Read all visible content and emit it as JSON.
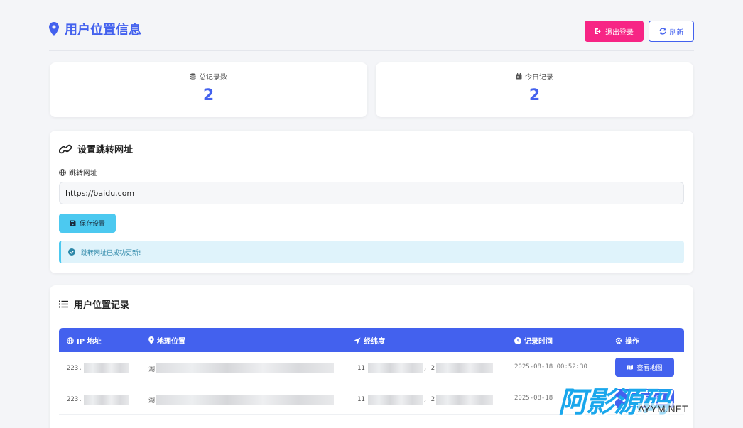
{
  "header": {
    "title": "用户位置信息",
    "logout_label": "退出登录",
    "refresh_label": "刷新"
  },
  "stats": [
    {
      "label": "总记录数",
      "value": "2",
      "icon": "database-icon"
    },
    {
      "label": "今日记录",
      "value": "2",
      "icon": "calendar-icon"
    }
  ],
  "settings": {
    "title": "设置跳转网址",
    "field_label": "跳转网址",
    "url_value": "https://baidu.com",
    "save_label": "保存设置",
    "alert_text": "跳转网址已成功更新!"
  },
  "records": {
    "title": "用户位置记录",
    "columns": {
      "ip": "IP 地址",
      "location": "地理位置",
      "coords": "经纬度",
      "time": "记录时间",
      "action": "操作"
    },
    "rows": [
      {
        "ip": "223.",
        "location": "湖",
        "lat": "11",
        "lng": ", 2",
        "time": "2025-08-18 00:52:30",
        "action": "查看地图"
      },
      {
        "ip": "223.",
        "location": "湖",
        "lat": "11",
        "lng": ", 2",
        "time": "2025-08-18",
        "action": "查看地图"
      }
    ]
  },
  "watermark": {
    "text": "阿影源码",
    "sub": "AYYM.NET"
  },
  "colors": {
    "primary": "#4361ee",
    "danger": "#f72585",
    "info": "#4cc9f0",
    "background": "#f4f5f8"
  }
}
